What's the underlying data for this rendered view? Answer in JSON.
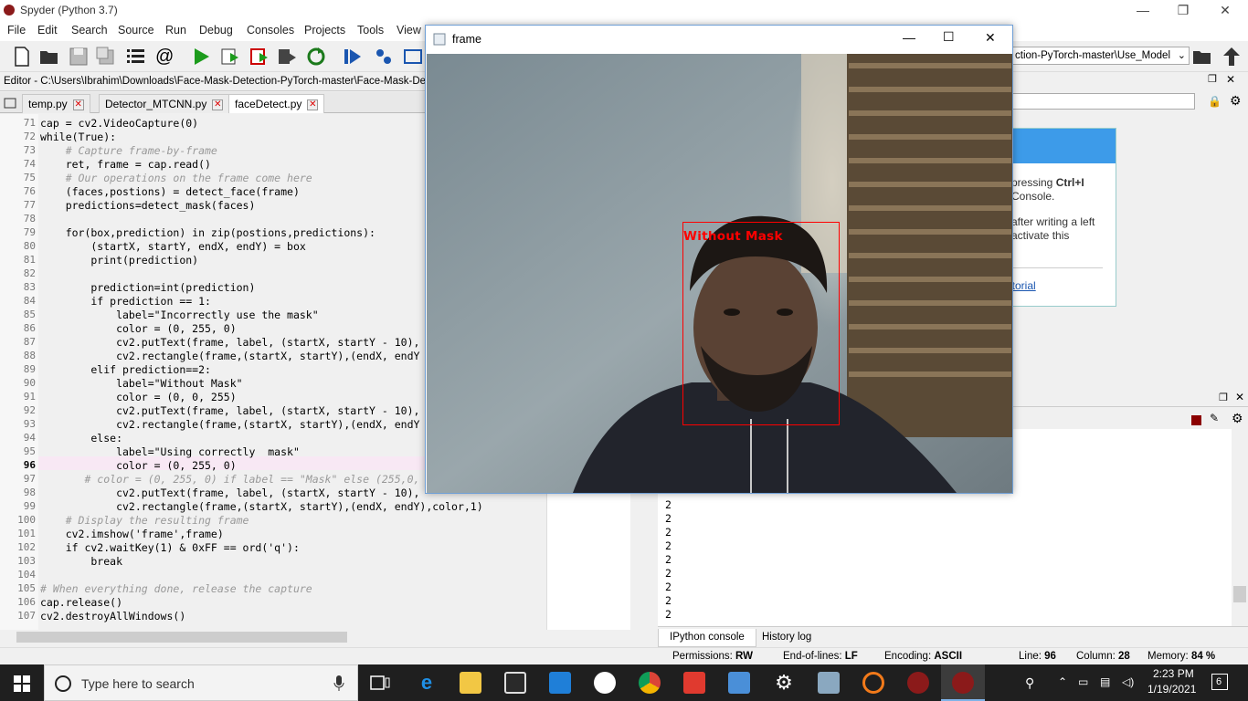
{
  "app": {
    "title": "Spyder (Python 3.7)",
    "minimize": "—",
    "restore": "❐",
    "close": "✕"
  },
  "menu": [
    "File",
    "Edit",
    "Search",
    "Source",
    "Run",
    "Debug",
    "Consoles",
    "Projects",
    "Tools",
    "View"
  ],
  "toolbar": {
    "path_fragment": "ction-PyTorch-master\\Use_Model",
    "at_sign": "@"
  },
  "editor": {
    "path": "Editor - C:\\Users\\Ibrahim\\Downloads\\Face-Mask-Detection-PyTorch-master\\Face-Mask-Detectio",
    "tabs": [
      {
        "label": "temp.py"
      },
      {
        "label": "Detector_MTCNN.py"
      },
      {
        "label": "faceDetect.py"
      }
    ],
    "close_glyph": "✕",
    "line_numbers": [
      "71",
      "72",
      "73",
      "74",
      "75",
      "76",
      "77",
      "78",
      "79",
      "80",
      "81",
      "82",
      "83",
      "84",
      "85",
      "86",
      "87",
      "88",
      "89",
      "90",
      "91",
      "92",
      "93",
      "94",
      "95",
      "96",
      "97",
      "98",
      "99",
      "100",
      "101",
      "102",
      "103",
      "104",
      "105",
      "106",
      "107"
    ],
    "lines": [
      "cap = cv2.VideoCapture(0)",
      "while(True):",
      "    # Capture frame-by-frame",
      "    ret, frame = cap.read()",
      "    # Our operations on the frame come here",
      "    (faces,postions) = detect_face(frame)",
      "    predictions=detect_mask(faces)",
      "",
      "    for(box,prediction) in zip(postions,predictions):",
      "        (startX, startY, endX, endY) = box",
      "        print(prediction)",
      "",
      "        prediction=int(prediction)",
      "        if prediction == 1:",
      "            label=\"Incorrectly use the mask\"",
      "            color = (0, 255, 0)",
      "            cv2.putText(frame, label, (startX, startY - 10),",
      "            cv2.rectangle(frame,(startX, startY),(endX, endY",
      "        elif prediction==2:",
      "            label=\"Without Mask\"",
      "            color = (0, 0, 255)",
      "            cv2.putText(frame, label, (startX, startY - 10),",
      "            cv2.rectangle(frame,(startX, startY),(endX, endY",
      "        else:",
      "            label=\"Using correctly  mask\"",
      "            color = (0, 255, 0)",
      "       # color = (0, 255, 0) if label == \"Mask\" else (255,0,",
      "            cv2.putText(frame, label, (startX, startY - 10),",
      "            cv2.rectangle(frame,(startX, startY),(endX, endY),color,1)",
      "    # Display the resulting frame",
      "    cv2.imshow('frame',frame)",
      "    if cv2.waitKey(1) & 0xFF == ord('q'):",
      "        break",
      "",
      "# When everything done, release the capture",
      "cap.release()",
      "cv2.destroyAllWindows()"
    ]
  },
  "help": {
    "line1a": "pressing ",
    "line1b": "Ctrl+I",
    "line2": "Console.",
    "line3": "after writing a left",
    "line4": "activate this",
    "link": "utorial"
  },
  "console": {
    "outputs": [
      "2",
      "2",
      "2",
      "2",
      "2",
      "2",
      "2",
      "2",
      "2"
    ],
    "tabs": [
      "IPython console",
      "History log"
    ]
  },
  "status": {
    "permissions_label": "Permissions:",
    "permissions": "RW",
    "eol_label": "End-of-lines:",
    "eol": "LF",
    "encoding_label": "Encoding:",
    "encoding": "ASCII",
    "line_label": "Line:",
    "line": "96",
    "column_label": "Column:",
    "column": "28",
    "memory_label": "Memory:",
    "memory": "84 %"
  },
  "frame_window": {
    "title": "frame",
    "detection_label": "Without Mask",
    "detection_color": "#ff0000"
  },
  "taskbar": {
    "search_placeholder": "Type here to search",
    "time": "2:23 PM",
    "date": "1/19/2021",
    "notifications": "6"
  }
}
